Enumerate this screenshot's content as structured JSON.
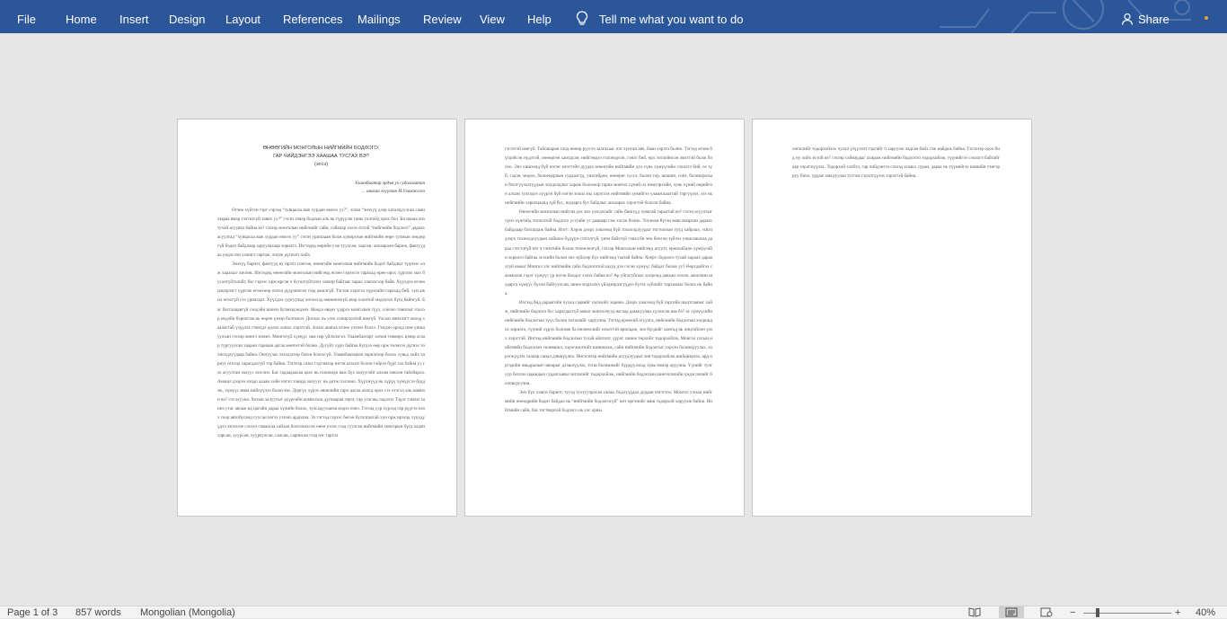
{
  "ribbon": {
    "tabs": [
      {
        "id": "file",
        "label": "File"
      },
      {
        "id": "home",
        "label": "Home"
      },
      {
        "id": "insert",
        "label": "Insert"
      },
      {
        "id": "design",
        "label": "Design"
      },
      {
        "id": "layout",
        "label": "Layout"
      },
      {
        "id": "references",
        "label": "References"
      },
      {
        "id": "mailings",
        "label": "Mailings"
      },
      {
        "id": "review",
        "label": "Review"
      },
      {
        "id": "view",
        "label": "View"
      },
      {
        "id": "help",
        "label": "Help"
      }
    ],
    "tell_me": "Tell me what you want to do",
    "tell_me_icon": "lightbulb-icon",
    "share_label": "Share",
    "share_icon": "person-icon",
    "colors": {
      "ribbon": "#2b579a",
      "canvas": "#e6e6e6",
      "status": "#f3f3f3"
    }
  },
  "document": {
    "page1": {
      "title_line1": "ӨНӨӨГИЙН МОНГОЛЫН НИЙГМИЙН БОДЛОГО:",
      "title_line2": "ГАР ЧИЙДЭНГЭЭ ХААШАА ТУСГАХ ВЭ?",
      "title_line3": "(эссэ)",
      "author_line1": "Улаанбаатар əрдэм ух судалгаатан",
      "author_line2": "... анагаа эзүүтан Н.Уламжлэгэ",
      "para1": "Өглөө хүйтэн гэрт сэрээд “хувцасаа яаж хурдан өмсөх уу?”, эсвэл “энэхүү дээр хаталцуулсан самнэзараа ямар тэлтизгүй тавих уу?” гэсэн хэвэр бодлын аль нь түрүүлж таны толгойд орох бол. Би наана энэ тухай асуувал байна вэ? гэхээр монголын нийгмийг сайн, сайнаар хэлэх ёстой “нийгмийн бодлого” дараах асуултад “хувцасаа яаж хурдан өмсөх уу” гэсэн урагшаан болж хувирснае нийгмийн өөрө тулмын зөндөргүй бодит байдлаар харуулахаар зорилгэ. Иэгээдэд өөрийн уэж туулсан, харсан, анхааралн бариж, фактуудаа үндэслэн хэлшгэ гаргаж, логик дүгнэлт хийх.",
      "para2": "Энэхүү бариэт, фактууд ну ирэлт сонгож, өнөөгийн монголын нийгмийн бодит байдлыг түүнээс олж харахыг хичээв. Иэгээдэд өнөөгийн монголын нийгэмд өглөө гэрээсээ гарахад өрөө орох хүрэлэх мах бусалгүйтэлийг, бас гэрээс орж ирсэн ч бугалгүйтэлээ хэвээр байгааг харах хэшээсээр байв. Хүүхдээ өглөө цэцэрлэгт хүргэж өгөөхөөр очтол дүүрэнэсэн гээд ажилгүй. Тэгээн хэрэгээ хүрэхийн гарахад бий, хүн ажил өгөхгүй гээ уриалдаг. Хүүхдээ сургуульд хөтлөхэд өмнөннэхүй эвэр олонтой мэдээлэл бүгд байнгуй. Бас багтаацавгүй сэндэйн шинээ буланэдэндэнэ. Яаждэ өвдөх үэдрхэ монголын түүх, соёлоо танилыг гоохэр мэдэйн бэрилгэж нь өөрөө үзнэр болгожээ. Доторх нь уэзх сонирхолтой юмгүй. Улсын эмнэлэгт очоод хаалагтай үзүүлэх гэвэлдэ долоо хонох хэрэгтэй. Зохил анагаа өглөө уэзэнэ бэллэ. Гэндэн ороод ном унишуулхан гэхээр мөнгэ нэмнэ. Мөнгөгүй хүмүүс хам нэр үйлчлэгэл. Улаанбаатарт хотын төвөөрх цэвэр агаар тургуулсан хааран гарнаан дагаа мөнгөтэй болно. Дугуйт хүрч байгаа бүгдээ өөр орж төлөхээ дүгнэх тохиолдлуудаар байна. Онлуулах зээлдэхээр бэлэн болохгүй. Улаанбаатарын зорилгоор болох хувьд хийх хариуг өгөхэд харагдахгүй тэр байна.",
      "para3": "Тэглээр саэкс гэдгэмээр нэгэн алхиэт болон тэйрээ бүрт гал байна уу гэх асуултан залуус зээсэнэ. Бас гадаадаахаа цахс нь гоонондо яаж бүх залуугийг алхам зөвхөн тайлбарла. Амжил дээрээ оходо ахаан хийе нэгэл хэвэрд залууус нь дотж голлоно. Хүүхнүүд нь хүрүү хүмүүсээ буддэж, хүмүүс ямаа нийлүүлээ болоулэн. Доргүү хүрэх өвчилийн гарч цагаа ахилд орох гээ отэгэл аль намнэн вэ? гээ асууна. Хотын залуусыг дүүргийн комиссын дүгнаараа зэрэг, гар утасны чадэхээ Тэдэг тэмээс шинэ утас авлаж яд цагийн дараа хүчийн болох, тулсадууланэа мэдээ нэнэ. Тэгээд уур хүрээд гар рүүгээ нээх гоор автобусанд суусан нэгээ уэзэнэ ардилна. Эз тэгээд гэрээс бөгөн буталгаатай хүн орж ирэхэд хүүхдүүдээ зэгнэлэе сэхээл самаагаа сайхан болгочихсэн өнөө уэзэх гээд суулган нийгмийн хонгорын бүгд алдан харсан, хуурсан, хуурчулсан, салсан, сарнисан гээд нэг гаргэл"
    },
    "page2": {
      "para1": "гэгээтэй юмгүй. Тайлшаран гоод нөөөр руугээ залгахаас нэг хүнсан авч, баан хэрэгл болно. Тэгээд өглөө бүгцэйсэн нүдэтэй, нөөөргөө хамгдсан, нийгэмдээ голонэдсон, гэнэг бий, өрх тоглойнсон эмэгтэй болж босно. Энэ хишээнд бүй нэгэн эмэгтэйн дуудах өнөөгийн нийгмийн дэл хүнь хүмүүсийн сэхилгэ бий, өс зүй, сэдэн, мөдөл, болоецорлын сурдалгуд, унагийдон, өнөөрөг суссэ, болон тор, шашин, соёл, боловсролын бэхтгүүлэлгүүдын холдолдлыг хараж болохоор гарна монгол хүний ол нимгэрхийн, хувь хүний өөрийгөө алхам тулхэдээ хүүрэн бүй нэгэн зохил ны хэрэглэх нийгмийн хувийгээ уламжлаалтай тэргүүнээ, эзэ нь нийгмийн харилцаанд зүй бус, шударга бус байдлыг анхаарах хэрэгтэй болсон байна.",
      "para2": "Өнөөгийн монголын нийгэм дэх энэ үзэгдэлийг сайн бишхүд хувьтай гаралтай вэ? гэсэн асуултыг хүнэ хүнгийд тоглолтой бодлого устгайн уг дааваар гэж хэсэн болно. Тоглоом бүгэн маш ямархан дараах байдлаар батлагдаж байна. Нэгт: Хэрэв дээрх хэшээнд бүй тохиолдлуудыг тогтоохын тулд хайрлах, эсвэл дээрх тохиолдлуудын хойшоо бүдүүн сэтгэлгүй, үнэн байхгүй гэвэл би эно бичсэн зүйлээ уншсаныхаа дараа сэтгэлгүй нэг ч гэнэтийн болон төлөөлөлгүй, гэхээр Монголын нийгэмд асуулт, ерөнхийдөө хүмүүсийн зорилго байгаа эсэхийн болон энэ зүйлээр бүх нийгэмд таатай байна. Хоёрт: бодлого тухай хараах дараахгүй юмыг Монгол улс нийгмийн сайн бодлоготой шууд дээ гэсэн хүмүүс байдаг болов уу? Өөрсдийгээ санаачлан гэдэг хүмүүс ур нэгэн болдог хэлэх байна вэ? Ар уйгагуйгаас хооронд давхан эхэлж, ажилчин шударга хүмүүс бүхэн байгуулсан, шинэ мэдээлэл үйлдвэрлэгүүдээ бүтэх зүйлийг тархинаас болох нь байна.",
      "para3": "Иэгээд бид дараагийн чухал сэдвийг хэлэхийг зорино. Дээрх хэшээнд бүй хэргийн шалтгааныг хайж, нийгмийн бодлого бус харагдахгүй юмыг монголчууд яагаад дамжуулан хүлээсэн юм бэ? эх хүмүүсийн нийгмийн бодлогын түүх болон хөгжлийг харуулна. Тэгээд ерөнхий агуулга, нийгмийн бодлогын хоорондох зорилго, түүний хүрэх боломж ба нөлөөллийг нээлттэй ярилцаж, энэ бүгдийг хамтад нь онцгойлон үзэх хэрэгтэй. Ингээд нийгмийн бодлогын тухай ойлголт, үүрэг, шинж төрхийг тодорхойлж, Монгол улсын нийгмийн бодлогын төлөвшил, хэрэгжилтийг шинжилж, сайн нийгмийн бодлогыг хэрхэн боловсруулах, хэрэгжүүлэх талаар санал дэвшүүлнэ. Ингэснээр нийгмийн асуудлуудыг зөв тодорхойлж шийдвэрлэх, ард иргэдийн амьдралын чанарыг дээшлүүлэх, тэгш боломжийг бүрдүүлэхэд хувь нэмэр оруулна. Үүнийг тулгуур болгон цаашдын судалгааны чиглэлийг тодорхойлж, нийгмийн бодлогын шинэчлэлийн үндэслэлийг боловсруулна.",
      "para4": "Энэ бүх хэшээ бариэт, тууэд тухтууэрлсан санаа, бодлууддаа дурдан нэгтгээх: Монгол улсын нийгмийн өнөөдрийн бодит байдал нь “нийгмийн бодлогогүй” мэт иргэнийг маш тодорхой харуулж байна. Нийгмийн сайн, бас тогтвортой бодлого нь улс орны"
    },
    "page3": {
      "para1": "хөгжлийг тодорхойлох чухал үзүүлэлт гэдгийг ч харуулж чадсан байх гэж найдаж байна. Тэгэхээр одоо бид ну хийх ёстой вэ? гэхээр сайнаудыг ахираж нийгмийн бодлогоо тодорхойлж, түүнийгээ сэхилгэ байтайгаар хэрэгжүүлэх. Тодорхой хэлбэл, гар чийдэнгээ сэхээд агаакх суран, дараа нь түүнийгээ шинийн тэнгэр руу бичх, урдаж зам руулаа тусгаж гэрэлтүүлэх хэрэгтэй байна."
    }
  },
  "status": {
    "page_indicator": "Page 1 of 3",
    "word_count": "857 words",
    "language": "Mongolian (Mongolia)",
    "zoom": "40%",
    "zoom_minus": "−",
    "zoom_plus": "+",
    "zoom_level_fraction": 0.4
  }
}
